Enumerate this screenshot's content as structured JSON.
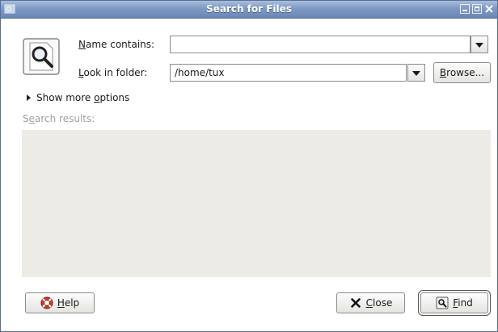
{
  "window": {
    "title": "Search for Files"
  },
  "form": {
    "name_label_accel": "N",
    "name_label_rest": "ame contains:",
    "name_value": "",
    "folder_label_accel": "L",
    "folder_label_rest": "ook in folder:",
    "folder_value": "/home/tux",
    "browse_accel": "B",
    "browse_rest": "rowse..."
  },
  "options": {
    "prefix": "Show more ",
    "accel": "o",
    "rest": "ptions"
  },
  "results": {
    "label_pre": "S",
    "label_accel": "e",
    "label_rest": "arch results:"
  },
  "buttons": {
    "help_accel": "H",
    "help_rest": "elp",
    "close_accel": "C",
    "close_rest": "lose",
    "find_accel": "F",
    "find_rest": "ind"
  },
  "icons": {
    "app": "app-icon",
    "search": "magnifier-icon",
    "help": "lifebuoy-icon",
    "close": "x-icon",
    "find": "find-icon",
    "expander": "triangle-right-icon"
  },
  "colors": {
    "titlebar": "#7e99c4",
    "results_bg": "#edebe5"
  }
}
